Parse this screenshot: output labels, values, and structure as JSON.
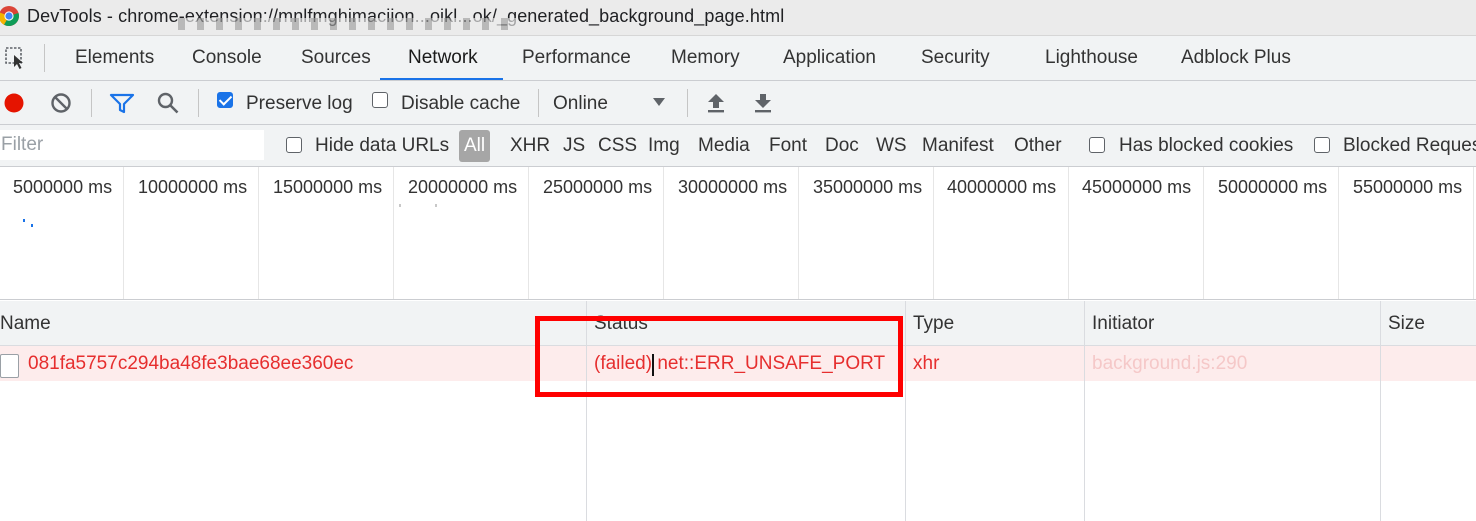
{
  "window": {
    "title": "DevTools - chrome-extension://mnlfmghimaciion...oikl...ok/_generated_background_page.html"
  },
  "tabs": [
    {
      "label": "Elements",
      "active": false
    },
    {
      "label": "Console",
      "active": false
    },
    {
      "label": "Sources",
      "active": false
    },
    {
      "label": "Network",
      "active": true
    },
    {
      "label": "Performance",
      "active": false
    },
    {
      "label": "Memory",
      "active": false
    },
    {
      "label": "Application",
      "active": false
    },
    {
      "label": "Security",
      "active": false
    },
    {
      "label": "Lighthouse",
      "active": false
    },
    {
      "label": "Adblock Plus",
      "active": false
    }
  ],
  "toolbar": {
    "icons": [
      "record-icon",
      "clear-icon",
      "filter-icon",
      "search-icon",
      "upload-icon",
      "download-icon"
    ],
    "preserve_log_label": "Preserve log",
    "preserve_log_checked": true,
    "disable_cache_label": "Disable cache",
    "disable_cache_checked": false,
    "throttling_value": "Online"
  },
  "filterbar": {
    "filter_placeholder": "Filter",
    "hide_data_urls_label": "Hide data URLs",
    "types": [
      "All",
      "XHR",
      "JS",
      "CSS",
      "Img",
      "Media",
      "Font",
      "Doc",
      "WS",
      "Manifest",
      "Other"
    ],
    "selected_type": "All",
    "has_blocked_cookies_label": "Has blocked cookies",
    "blocked_requests_label": "Blocked Reques"
  },
  "overview": {
    "ticks": [
      "5000000 ms",
      "10000000 ms",
      "15000000 ms",
      "20000000 ms",
      "25000000 ms",
      "30000000 ms",
      "35000000 ms",
      "40000000 ms",
      "45000000 ms",
      "50000000 ms",
      "55000000 ms"
    ]
  },
  "grid": {
    "columns": [
      "Name",
      "Status",
      "Type",
      "Initiator",
      "Size"
    ],
    "rows": [
      {
        "name": "081fa5757c294ba48fe3bae68ee360ec",
        "status": "(failed) net::ERR_UNSAFE_PORT",
        "type": "xhr",
        "initiator": "background.js:290",
        "size": "",
        "failed": true
      }
    ]
  },
  "colors": {
    "accent": "#1a73e8",
    "error_text": "#e62e2e",
    "error_row_bg": "#fdecec",
    "annotation": "#ff0000",
    "record": "#e51400"
  }
}
